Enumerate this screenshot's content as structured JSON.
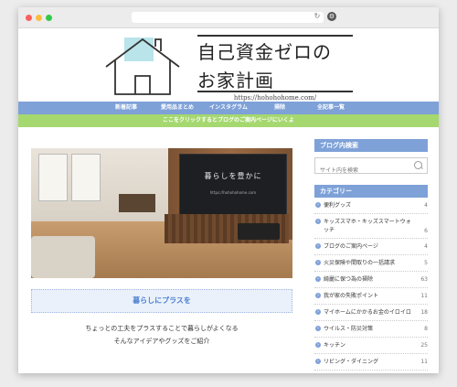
{
  "site": {
    "title_line1": "自己資金ゼロの",
    "title_line2": "お家計画",
    "url": "https://hohohohome.com/"
  },
  "nav": [
    "新着記事",
    "愛用品まとめ",
    "インスタグラム",
    "掃除",
    "全記事一覧"
  ],
  "notice": "ここをクリックするとブログのご案内ページにいくよ",
  "hero": {
    "tv_text": "暮らしを豊かに",
    "tv_url": "https://hohohohome.com"
  },
  "main": {
    "section_title": "暮らしにプラスを",
    "desc_line1": "ちょっとの工夫をプラスすることで暮らしがよくなる",
    "desc_line2": "そんなアイデアやグッズをご紹介"
  },
  "sidebar": {
    "search_head": "ブログ内検索",
    "search_placeholder": "サイト内を検索",
    "category_head": "カテゴリー",
    "categories": [
      {
        "label": "便利グッズ",
        "count": "4"
      },
      {
        "label": "キッズスマホ・キッズスマートウォッチ",
        "count": "6"
      },
      {
        "label": "ブログのご案内ページ",
        "count": "4"
      },
      {
        "label": "火災保険や間取りの一括請求",
        "count": "5"
      },
      {
        "label": "綺麗に保つ為の掃除",
        "count": "63"
      },
      {
        "label": "我が家の失敗ポイント",
        "count": "11"
      },
      {
        "label": "マイホームにかかるお金のイロイロ",
        "count": "18"
      },
      {
        "label": "ウイルス・防災対策",
        "count": "8"
      },
      {
        "label": "キッチン",
        "count": "25"
      },
      {
        "label": "リビング・ダイニング",
        "count": "11"
      }
    ]
  },
  "colors": {
    "nav": "#7ea1d8",
    "notice": "#a5d86f",
    "house_fill": "#b9e4ea"
  }
}
